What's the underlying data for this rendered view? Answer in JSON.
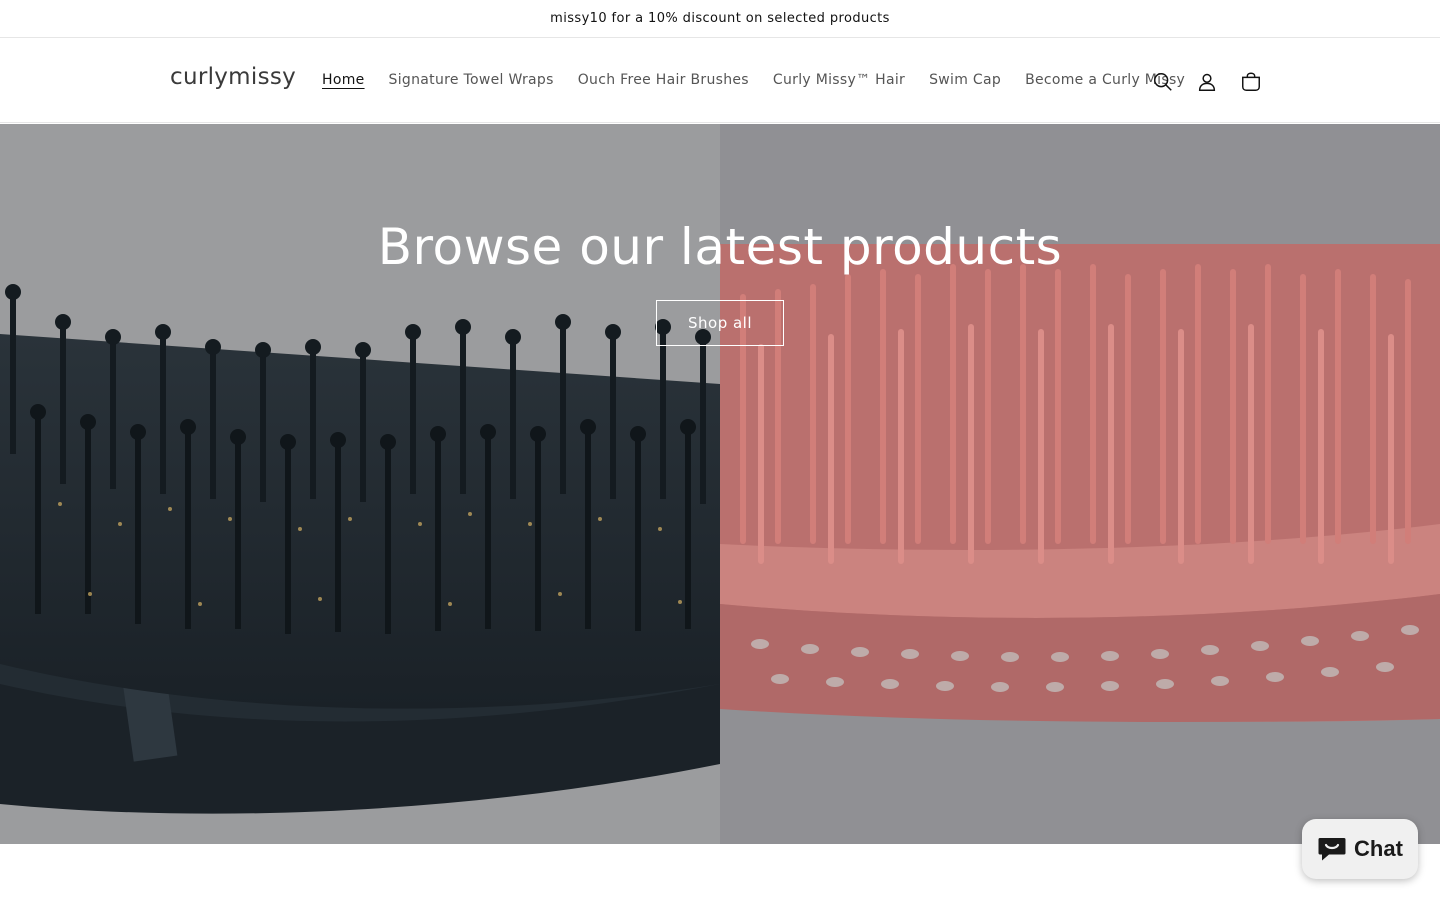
{
  "announcement": {
    "text": "missy10 for a 10% discount on selected products"
  },
  "header": {
    "logo": "curlymissy",
    "nav": [
      {
        "label": "Home",
        "active": true
      },
      {
        "label": "Signature Towel Wraps",
        "active": false
      },
      {
        "label": "Ouch Free Hair Brushes",
        "active": false
      },
      {
        "label": "Curly Missy™ Hair",
        "active": false
      },
      {
        "label": "Swim Cap",
        "active": false
      },
      {
        "label": "Become a Curly Missy",
        "active": false
      }
    ],
    "icons": [
      "search-icon",
      "account-icon",
      "cart-icon"
    ]
  },
  "hero": {
    "title": "Browse our latest products",
    "button_label": "Shop all",
    "left_image": "black-bristle-brush",
    "right_image": "coral-pin-brush"
  },
  "chat": {
    "label": "Chat",
    "icon": "chat-bubble-icon"
  },
  "colors": {
    "hero_overlay": "#909194",
    "brush_black": "#1c2329",
    "brush_coral": "#e9726a"
  }
}
